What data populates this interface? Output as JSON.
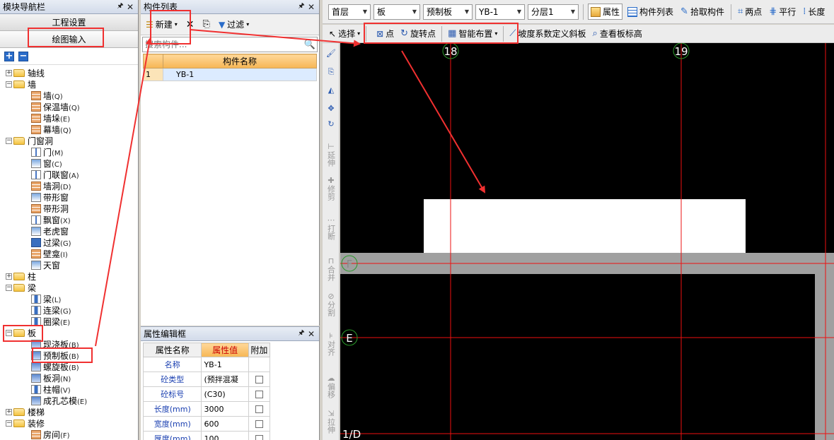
{
  "nav": {
    "title": "模块导航栏",
    "project_settings": "工程设置",
    "drawing_input": "绘图输入",
    "expand_all": "+",
    "collapse_all": "−",
    "tree": [
      {
        "type": "folder",
        "label": "轴线",
        "exp": "+"
      },
      {
        "type": "folder",
        "label": "墙",
        "exp": "−"
      },
      {
        "type": "leaf",
        "icon": "wall",
        "label": "墙",
        "key": "(Q)"
      },
      {
        "type": "leaf",
        "icon": "wall",
        "label": "保温墙",
        "key": "(Q)"
      },
      {
        "type": "leaf",
        "icon": "wall",
        "label": "墙垛",
        "key": "(E)"
      },
      {
        "type": "leaf",
        "icon": "wall",
        "label": "幕墙",
        "key": "(Q)"
      },
      {
        "type": "folder",
        "label": "门窗洞",
        "exp": "−"
      },
      {
        "type": "leaf",
        "icon": "door",
        "label": "门",
        "key": "(M)"
      },
      {
        "type": "leaf",
        "icon": "window",
        "label": "窗",
        "key": "(C)"
      },
      {
        "type": "leaf",
        "icon": "door",
        "label": "门联窗",
        "key": "(A)"
      },
      {
        "type": "leaf",
        "icon": "wall",
        "label": "墙洞",
        "key": "(D)"
      },
      {
        "type": "leaf",
        "icon": "window",
        "label": "带形窗",
        "key": ""
      },
      {
        "type": "leaf",
        "icon": "wall",
        "label": "带形洞",
        "key": ""
      },
      {
        "type": "leaf",
        "icon": "door",
        "label": "飘窗",
        "key": "(X)"
      },
      {
        "type": "leaf",
        "icon": "window",
        "label": "老虎窗",
        "key": ""
      },
      {
        "type": "leaf",
        "icon": "blue",
        "label": "过梁",
        "key": "(G)"
      },
      {
        "type": "leaf",
        "icon": "wall",
        "label": "壁龛",
        "key": "(I)"
      },
      {
        "type": "leaf",
        "icon": "window",
        "label": "天窗",
        "key": ""
      },
      {
        "type": "folder",
        "label": "柱",
        "exp": "+"
      },
      {
        "type": "folder",
        "label": "梁",
        "exp": "−"
      },
      {
        "type": "leaf",
        "icon": "col",
        "label": "梁",
        "key": "(L)"
      },
      {
        "type": "leaf",
        "icon": "col",
        "label": "连梁",
        "key": "(G)"
      },
      {
        "type": "leaf",
        "icon": "col",
        "label": "圈梁",
        "key": "(E)"
      },
      {
        "type": "folder",
        "label": "板",
        "exp": "−"
      },
      {
        "type": "leaf",
        "icon": "slab",
        "label": "现浇板",
        "key": "(B)"
      },
      {
        "type": "leaf",
        "icon": "slab",
        "label": "预制板",
        "key": "(B)"
      },
      {
        "type": "leaf",
        "icon": "slab",
        "label": "螺旋板",
        "key": "(B)"
      },
      {
        "type": "leaf",
        "icon": "slab",
        "label": "板洞",
        "key": "(N)"
      },
      {
        "type": "leaf",
        "icon": "col",
        "label": "柱帽",
        "key": "(V)"
      },
      {
        "type": "leaf",
        "icon": "slab",
        "label": "成孔芯模",
        "key": "(E)"
      },
      {
        "type": "folder",
        "label": "楼梯",
        "exp": "+"
      },
      {
        "type": "folder",
        "label": "装修",
        "exp": "−"
      },
      {
        "type": "leaf",
        "icon": "wall",
        "label": "房间",
        "key": "(F)"
      }
    ]
  },
  "components": {
    "title": "构件列表",
    "new_label": "新建",
    "filter_label": "过滤",
    "search_placeholder": "搜索构件...",
    "header": "构件名称",
    "rows": [
      {
        "num": "1",
        "name": "YB-1"
      }
    ]
  },
  "properties": {
    "title": "属性编辑框",
    "col_name": "属性名称",
    "col_value": "属性值",
    "col_extra": "附加",
    "rows": [
      {
        "name": "名称",
        "value": "YB-1",
        "check": false
      },
      {
        "name": "砼类型",
        "value": "(预拌混凝",
        "check": true
      },
      {
        "name": "砼标号",
        "value": "(C30)",
        "check": true
      },
      {
        "name": "长度(mm)",
        "value": "3000",
        "check": true
      },
      {
        "name": "宽度(mm)",
        "value": "600",
        "check": true
      },
      {
        "name": "厚度(mm)",
        "value": "100",
        "check": true
      }
    ]
  },
  "toolbar": {
    "floor": "首层",
    "category": "板",
    "type": "预制板",
    "component": "YB-1",
    "layer": "分层1",
    "attr_btn": "属性",
    "list_btn": "构件列表",
    "pick_btn": "拾取构件",
    "two_point": "两点",
    "parallel": "平行",
    "length": "长度"
  },
  "toolbar2": {
    "select": "选择",
    "point": "点",
    "rotate_point": "旋转点",
    "smart_place": "智能布置",
    "slope_define": "坡度系数定义斜板",
    "view_elevation": "查看板标高"
  },
  "vstrip": {
    "extend": "延伸",
    "trim": "修剪",
    "break": "打断",
    "merge": "合并",
    "split": "分割",
    "align": "对齐",
    "offset": "偏移",
    "stretch": "拉伸"
  },
  "canvas": {
    "axis_18": "18",
    "axis_19": "19",
    "axis_F": "F",
    "axis_E": "E",
    "axis_1D": "1/D"
  }
}
